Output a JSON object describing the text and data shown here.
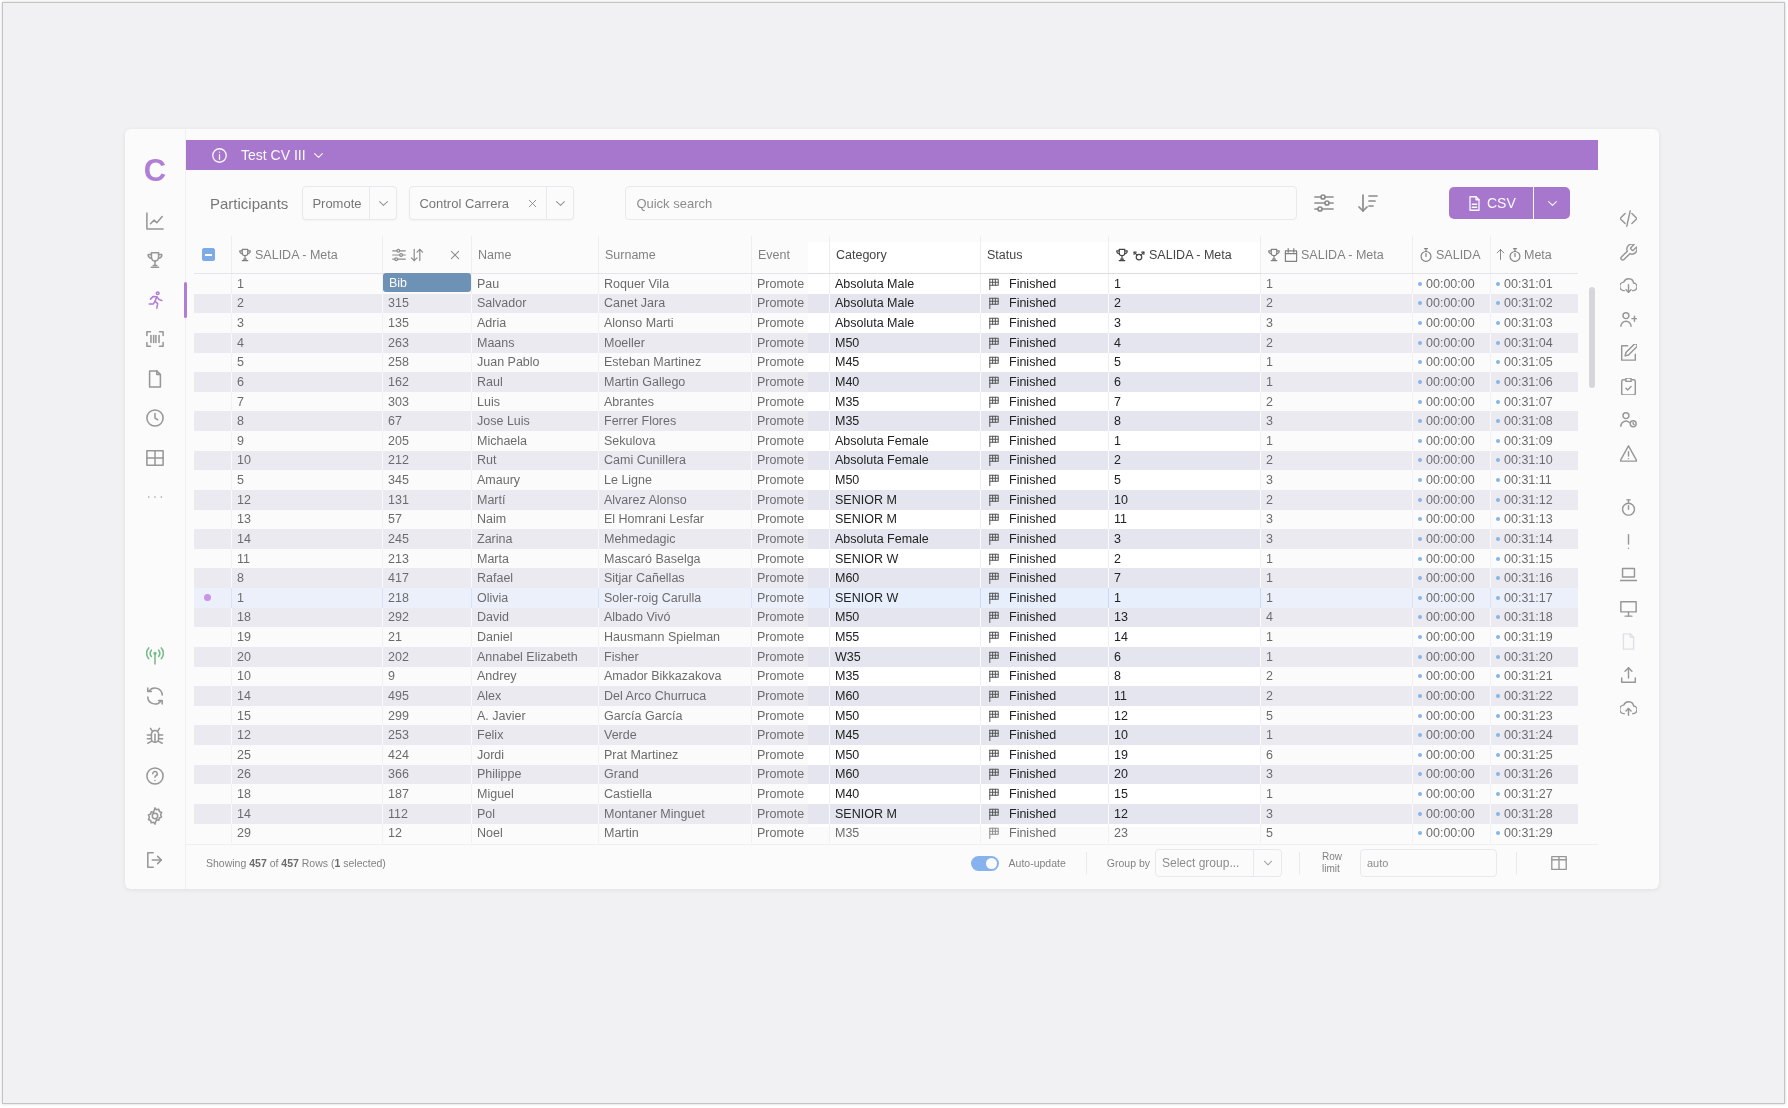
{
  "app": {
    "logo": "C"
  },
  "sidebar": {
    "nav": [
      {
        "selected": false
      },
      {
        "selected": false
      },
      {
        "selected": true
      },
      {
        "selected": false
      },
      {
        "selected": false
      },
      {
        "selected": false
      },
      {
        "selected": false
      }
    ],
    "connection": {
      "online": true
    }
  },
  "header": {
    "title": "Test CV III"
  },
  "toolbar": {
    "title": "Participants",
    "event_select": {
      "value": "Promote"
    },
    "control_select": {
      "value": "Control Carrera"
    },
    "search": {
      "placeholder": "Quick search"
    },
    "export_button": {
      "label": "CSV"
    }
  },
  "table": {
    "select_all": {
      "indeterminate": true
    },
    "columns": [
      {
        "label": "SALIDA - Meta",
        "sort_ascending": false
      },
      {
        "label": "Bib",
        "sort_ascending": false
      },
      {
        "label": "Name",
        "sort_ascending": false
      },
      {
        "label": "Surname",
        "sort_ascending": false
      },
      {
        "label": "Event",
        "sort_ascending": false
      },
      {
        "label": "Category",
        "sort_ascending": false
      },
      {
        "label": "Status",
        "sort_ascending": false
      },
      {
        "label": "SALIDA - Meta",
        "sort_ascending": false
      },
      {
        "label": "SALIDA - Meta",
        "sort_ascending": false
      },
      {
        "label": "SALIDA",
        "sort_ascending": false
      },
      {
        "label": "Meta",
        "sort_ascending": true
      }
    ],
    "rows": [
      {
        "selected": false,
        "salida_meta": "1",
        "name": "Pau",
        "surname": "Roquer Vila",
        "event": "Promote",
        "category": "Absoluta Male",
        "status": "Finished",
        "salida_meta_2": "1",
        "salida_meta_3": "1",
        "salida": "00:00:00",
        "meta": "00:31:01"
      },
      {
        "selected": false,
        "salida_meta": "2",
        "bib": "315",
        "name": "Salvador",
        "surname": "Canet Jara",
        "event": "Promote",
        "category": "Absoluta Male",
        "status": "Finished",
        "salida_meta_2": "2",
        "salida_meta_3": "2",
        "salida": "00:00:00",
        "meta": "00:31:02"
      },
      {
        "selected": false,
        "salida_meta": "3",
        "bib": "135",
        "name": "Adria",
        "surname": "Alonso Marti",
        "event": "Promote",
        "category": "Absoluta Male",
        "status": "Finished",
        "salida_meta_2": "3",
        "salida_meta_3": "3",
        "salida": "00:00:00",
        "meta": "00:31:03"
      },
      {
        "selected": false,
        "salida_meta": "4",
        "bib": "263",
        "name": "Maans",
        "surname": "Moeller",
        "event": "Promote",
        "category": "M50",
        "status": "Finished",
        "salida_meta_2": "4",
        "salida_meta_3": "2",
        "salida": "00:00:00",
        "meta": "00:31:04"
      },
      {
        "selected": false,
        "salida_meta": "5",
        "bib": "258",
        "name": "Juan Pablo",
        "surname": "Esteban Martinez",
        "event": "Promote",
        "category": "M45",
        "status": "Finished",
        "salida_meta_2": "5",
        "salida_meta_3": "1",
        "salida": "00:00:00",
        "meta": "00:31:05"
      },
      {
        "selected": false,
        "salida_meta": "6",
        "bib": "162",
        "name": "Raul",
        "surname": "Martin Gallego",
        "event": "Promote",
        "category": "M40",
        "status": "Finished",
        "salida_meta_2": "6",
        "salida_meta_3": "1",
        "salida": "00:00:00",
        "meta": "00:31:06"
      },
      {
        "selected": false,
        "salida_meta": "7",
        "bib": "303",
        "name": "Luis",
        "surname": "Abrantes",
        "event": "Promote",
        "category": "M35",
        "status": "Finished",
        "salida_meta_2": "7",
        "salida_meta_3": "2",
        "salida": "00:00:00",
        "meta": "00:31:07"
      },
      {
        "selected": false,
        "salida_meta": "8",
        "bib": "67",
        "name": "Jose Luis",
        "surname": "Ferrer Flores",
        "event": "Promote",
        "category": "M35",
        "status": "Finished",
        "salida_meta_2": "8",
        "salida_meta_3": "3",
        "salida": "00:00:00",
        "meta": "00:31:08"
      },
      {
        "selected": false,
        "salida_meta": "9",
        "bib": "205",
        "name": "Michaela",
        "surname": "Sekulova",
        "event": "Promote",
        "category": "Absoluta Female",
        "status": "Finished",
        "salida_meta_2": "1",
        "salida_meta_3": "1",
        "salida": "00:00:00",
        "meta": "00:31:09"
      },
      {
        "selected": false,
        "salida_meta": "10",
        "bib": "212",
        "name": "Rut",
        "surname": "Cami Cunillera",
        "event": "Promote",
        "category": "Absoluta Female",
        "status": "Finished",
        "salida_meta_2": "2",
        "salida_meta_3": "2",
        "salida": "00:00:00",
        "meta": "00:31:10"
      },
      {
        "selected": false,
        "salida_meta": "5",
        "bib": "345",
        "name": "Amaury",
        "surname": "Le Ligne",
        "event": "Promote",
        "category": "M50",
        "status": "Finished",
        "salida_meta_2": "5",
        "salida_meta_3": "3",
        "salida": "00:00:00",
        "meta": "00:31:11"
      },
      {
        "selected": false,
        "salida_meta": "12",
        "bib": "131",
        "name": "Martí",
        "surname": "Alvarez Alonso",
        "event": "Promote",
        "category": "SENIOR M",
        "status": "Finished",
        "salida_meta_2": "10",
        "salida_meta_3": "2",
        "salida": "00:00:00",
        "meta": "00:31:12"
      },
      {
        "selected": false,
        "salida_meta": "13",
        "bib": "57",
        "name": "Naim",
        "surname": "El Homrani Lesfar",
        "event": "Promote",
        "category": "SENIOR M",
        "status": "Finished",
        "salida_meta_2": "11",
        "salida_meta_3": "3",
        "salida": "00:00:00",
        "meta": "00:31:13"
      },
      {
        "selected": false,
        "salida_meta": "14",
        "bib": "245",
        "name": "Zarina",
        "surname": "Mehmedagic",
        "event": "Promote",
        "category": "Absoluta Female",
        "status": "Finished",
        "salida_meta_2": "3",
        "salida_meta_3": "3",
        "salida": "00:00:00",
        "meta": "00:31:14"
      },
      {
        "selected": false,
        "salida_meta": "11",
        "bib": "213",
        "name": "Marta",
        "surname": "Mascaró Baselga",
        "event": "Promote",
        "category": "SENIOR W",
        "status": "Finished",
        "salida_meta_2": "2",
        "salida_meta_3": "1",
        "salida": "00:00:00",
        "meta": "00:31:15"
      },
      {
        "selected": false,
        "salida_meta": "8",
        "bib": "417",
        "name": "Rafael",
        "surname": "Sitjar Cañellas",
        "event": "Promote",
        "category": "M60",
        "status": "Finished",
        "salida_meta_2": "7",
        "salida_meta_3": "1",
        "salida": "00:00:00",
        "meta": "00:31:16"
      },
      {
        "selected": true,
        "salida_meta": "1",
        "bib": "218",
        "name": "Olivia",
        "surname": "Soler-roig Carulla",
        "event": "Promote",
        "category": "SENIOR W",
        "status": "Finished",
        "salida_meta_2": "1",
        "salida_meta_3": "1",
        "salida": "00:00:00",
        "meta": "00:31:17"
      },
      {
        "selected": false,
        "salida_meta": "18",
        "bib": "292",
        "name": "David",
        "surname": "Albado Vivó",
        "event": "Promote",
        "category": "M50",
        "status": "Finished",
        "salida_meta_2": "13",
        "salida_meta_3": "4",
        "salida": "00:00:00",
        "meta": "00:31:18"
      },
      {
        "selected": false,
        "salida_meta": "19",
        "bib": "21",
        "name": "Daniel",
        "surname": "Hausmann Spielman",
        "event": "Promote",
        "category": "M55",
        "status": "Finished",
        "salida_meta_2": "14",
        "salida_meta_3": "1",
        "salida": "00:00:00",
        "meta": "00:31:19"
      },
      {
        "selected": false,
        "salida_meta": "20",
        "bib": "202",
        "name": "Annabel Elizabeth",
        "surname": "Fisher",
        "event": "Promote",
        "category": "W35",
        "status": "Finished",
        "salida_meta_2": "6",
        "salida_meta_3": "1",
        "salida": "00:00:00",
        "meta": "00:31:20"
      },
      {
        "selected": false,
        "salida_meta": "10",
        "bib": "9",
        "name": "Andrey",
        "surname": "Amador Bikkazakova",
        "event": "Promote",
        "category": "M35",
        "status": "Finished",
        "salida_meta_2": "8",
        "salida_meta_3": "2",
        "salida": "00:00:00",
        "meta": "00:31:21"
      },
      {
        "selected": false,
        "salida_meta": "14",
        "bib": "495",
        "name": "Alex",
        "surname": "Del Arco Churruca",
        "event": "Promote",
        "category": "M60",
        "status": "Finished",
        "salida_meta_2": "11",
        "salida_meta_3": "2",
        "salida": "00:00:00",
        "meta": "00:31:22"
      },
      {
        "selected": false,
        "salida_meta": "15",
        "bib": "299",
        "name": "A. Javier",
        "surname": "García García",
        "event": "Promote",
        "category": "M50",
        "status": "Finished",
        "salida_meta_2": "12",
        "salida_meta_3": "5",
        "salida": "00:00:00",
        "meta": "00:31:23"
      },
      {
        "selected": false,
        "salida_meta": "12",
        "bib": "253",
        "name": "Felix",
        "surname": "Verde",
        "event": "Promote",
        "category": "M45",
        "status": "Finished",
        "salida_meta_2": "10",
        "salida_meta_3": "1",
        "salida": "00:00:00",
        "meta": "00:31:24"
      },
      {
        "selected": false,
        "salida_meta": "25",
        "bib": "424",
        "name": "Jordi",
        "surname": "Prat Martinez",
        "event": "Promote",
        "category": "M50",
        "status": "Finished",
        "salida_meta_2": "19",
        "salida_meta_3": "6",
        "salida": "00:00:00",
        "meta": "00:31:25"
      },
      {
        "selected": false,
        "salida_meta": "26",
        "bib": "366",
        "name": "Philippe",
        "surname": "Grand",
        "event": "Promote",
        "category": "M60",
        "status": "Finished",
        "salida_meta_2": "20",
        "salida_meta_3": "3",
        "salida": "00:00:00",
        "meta": "00:31:26"
      },
      {
        "selected": false,
        "salida_meta": "18",
        "bib": "187",
        "name": "Miguel",
        "surname": "Castiella",
        "event": "Promote",
        "category": "M40",
        "status": "Finished",
        "salida_meta_2": "15",
        "salida_meta_3": "1",
        "salida": "00:00:00",
        "meta": "00:31:27"
      },
      {
        "selected": false,
        "salida_meta": "14",
        "bib": "112",
        "name": "Pol",
        "surname": "Montaner Minguet",
        "event": "Promote",
        "category": "SENIOR M",
        "status": "Finished",
        "salida_meta_2": "12",
        "salida_meta_3": "3",
        "salida": "00:00:00",
        "meta": "00:31:28"
      },
      {
        "selected": false,
        "salida_meta": "29",
        "bib": "12",
        "name": "Noel",
        "surname": "Martin",
        "event": "Promote",
        "category": "M35",
        "status": "Finished",
        "salida_meta_2": "23",
        "salida_meta_3": "5",
        "salida": "00:00:00",
        "meta": "00:31:29"
      }
    ]
  },
  "footer": {
    "summary": "Showing **457** of **457** Rows (**1** selected)",
    "auto_update": {
      "label": "Auto-update",
      "on": true
    },
    "group_by": {
      "label": "Group by",
      "placeholder": "Select group..."
    },
    "row_limit": {
      "label": "Row limit",
      "placeholder": "auto"
    }
  },
  "right_toolbar": {
    "tools": [
      {
        "disabled": false
      },
      {
        "disabled": false
      },
      {
        "disabled": false
      },
      {
        "disabled": false
      },
      {
        "disabled": false
      },
      {
        "disabled": false
      },
      {
        "disabled": false
      },
      {
        "disabled": false
      },
      {
        "disabled": false
      },
      {
        "disabled": false
      },
      {
        "disabled": false
      },
      {
        "disabled": false
      },
      {
        "disabled": true
      },
      {
        "disabled": false
      },
      {
        "disabled": false
      }
    ]
  }
}
